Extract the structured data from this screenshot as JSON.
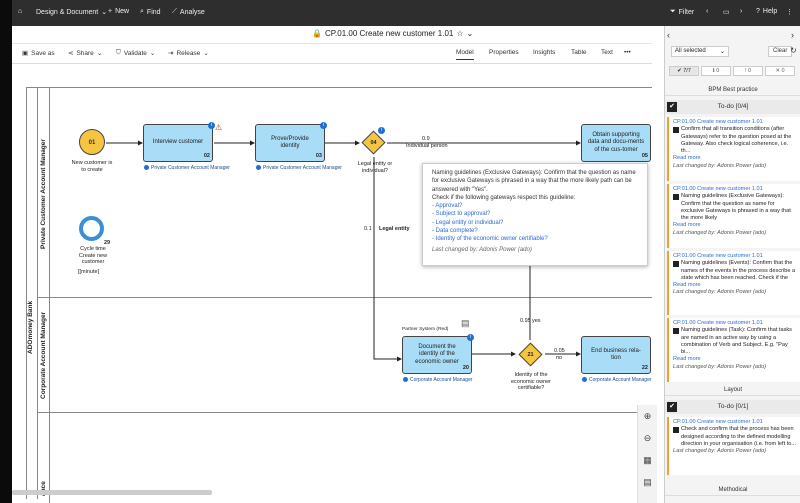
{
  "topbar": {
    "home_icon": "home-icon",
    "menu": "Design & Document",
    "new": "New",
    "find": "Find",
    "analyse": "Analyse",
    "filter": "Filter",
    "help": "Help"
  },
  "titlebar": {
    "title": "CP.01.00 Create new customer 1.01"
  },
  "toolbar": {
    "save_as": "Save as",
    "share": "Share",
    "validate": "Validate",
    "release": "Release",
    "tabs": [
      "Model",
      "Properties",
      "Insights",
      "Table",
      "Text"
    ],
    "more": "•••"
  },
  "diagram": {
    "pool": "ADOmoney Bank",
    "lanes": [
      "Private Customer Account Manager",
      "Corporate Account Manager",
      "ance"
    ],
    "start": {
      "num": "01",
      "label": "New customer is to create"
    },
    "tasks": [
      {
        "label": "Interview customer",
        "num": "02",
        "role": "Private Customer Account Manager"
      },
      {
        "label": "Prove/Provide identity",
        "num": "03",
        "role": "Private Customer Account Manager"
      },
      {
        "label": "Obtain supporting data and docu-ments of the cus-tomer",
        "num": "05",
        "role": ""
      },
      {
        "label": "Document the identity of the economic owner",
        "num": "20",
        "role": "Corporate Account Manager",
        "system": "Partner System (Red)"
      },
      {
        "label": "End business rela-tion",
        "num": "22",
        "role": "Corporate Account Manager"
      }
    ],
    "gateway1": {
      "num": "04",
      "label": "Legal entity or individual?",
      "edge1_val": "0.9",
      "edge1_lbl": "Individual person",
      "edge2_val": "0.1",
      "edge2_lbl": "Legal entity"
    },
    "gateway2": {
      "num": "21",
      "label": "Identity of the economic owner certifiable?",
      "edge1_val": "0.95",
      "edge1_lbl": "yes",
      "edge2_val": "0.05",
      "edge2_lbl": "no"
    },
    "cycle": {
      "num": "29",
      "label": "Cycle time Create new customer",
      "unit": "[[minute]"
    }
  },
  "tooltip": {
    "lines": [
      "Naming guidelines (Exclusive Gateways): Confirm that the question as name",
      "for exclusive Gateways is phrased in a way that the more likely path can be",
      "answered with \"Yes\".",
      "Check if the following gateways respect this guideline:"
    ],
    "links": [
      "- Approval?",
      "- Subject to approval?",
      "- Legal entity or individual?",
      "- Data complete?",
      "- Identity of the economic owner certifiable?"
    ],
    "changed_by": "Last changed by: Adonis Power (ado)"
  },
  "right_panel": {
    "select": "All selected",
    "clear": "Clear",
    "filters": [
      "✔ 7/7",
      "ℹ 0",
      "! 0",
      "✕ 0"
    ],
    "sec1": "BPM Best practice",
    "todo1": "To-do [0/4]",
    "cards": [
      {
        "title": "CP.01.00 Create new customer 1.01",
        "text": "Confirm that all transition conditions (after Gateways) refer to the question posed at the Gateway. Also check logical coherence, i.e. th...",
        "read_more": "Read more",
        "changed": "Last changed by: Adonis Power (ado)"
      },
      {
        "title": "CP.01.00 Create new customer 1.01",
        "text": "Naming guidelines (Exclusive Gateways): Confirm that the question as name for exclusive Gateways is phrased in a way that the more likely",
        "read_more": "Read more",
        "changed": "Last changed by: Adonis Power (ado)"
      },
      {
        "title": "CP.01.00 Create new customer 1.01",
        "text": "Naming guidelines (Events): Confirm that the names of the events in the process describe a state which has been reached. Check if the",
        "read_more": "Read more",
        "changed": "Last changed by: Adonis Power (ado)"
      },
      {
        "title": "CP.01.00 Create new customer 1.01",
        "text": "Naming guidelines (Task): Confirm that tasks are named in an active way by using a combination of Verb and Subject. E.g. \"Pay bi...",
        "read_more": "Read more",
        "changed": "Last changed by: Adonis Power (ado)"
      }
    ],
    "sec2": "Layout",
    "todo2": "To-do [0/1]",
    "card5": {
      "title": "CP.01.00 Create new customer 1.01",
      "text": "Check and confirm that the process has been designed according to the defined modelling direction in your organisation (i.e. from left to...",
      "changed": "Last changed by: Adonis Power (ado)"
    },
    "sec3": "Methodical"
  }
}
